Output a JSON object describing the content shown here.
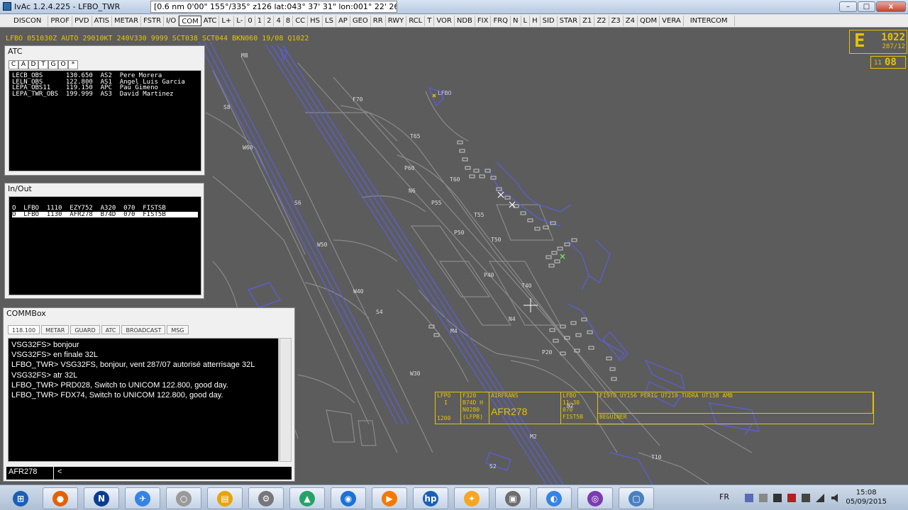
{
  "window": {
    "title": "IvAc 1.2.4.225 - LFBO_TWR",
    "readout": "[0.6 nm   0'00\"   155°/335°   z126    lat:043° 37' 31\"  lon:001° 22' 26\"]",
    "min": "–",
    "max": "□",
    "close": "x"
  },
  "toolbar": [
    "DISCON",
    "PROF",
    "PVD",
    "ATIS",
    "METAR",
    "FSTR",
    "I/O",
    "COM",
    "ATC",
    "L+",
    "L-",
    "0",
    "1",
    "2",
    "4",
    "8",
    "CC",
    "HS",
    "LS",
    "AP",
    "GEO",
    "RR",
    "RWY",
    "RCL",
    "T",
    "VOR",
    "NDB",
    "FIX",
    "FRQ",
    "N",
    "L",
    "H",
    "SID",
    "STAR",
    "Z1",
    "Z2",
    "Z3",
    "Z4",
    "QDM",
    "VERA",
    "INTERCOM"
  ],
  "toolbar_active": "COM",
  "metar": "LFBO 051030Z AUTO 29010KT 240V330 9999 SCT038 SCT044 BKN060 19/08 Q1022",
  "atis_box": {
    "letter": "E",
    "qnh": "1022",
    "wind": "287/12"
  },
  "clock_box": {
    "hour": "11",
    "min": "08"
  },
  "map_labels": [
    "M8",
    "S8",
    "W60",
    "F70",
    "LFBO",
    "T65",
    "P60",
    "N6",
    "T60",
    "S6",
    "P55",
    "T55",
    "P50",
    "T50",
    "W50",
    "P40",
    "T40",
    "W40",
    "S4",
    "M4",
    "N4",
    "P20",
    "W30",
    "N2",
    "M2",
    "T10",
    "S2"
  ],
  "atc_panel": {
    "title": "ATC",
    "tabs": [
      "C",
      "A",
      "D",
      "T",
      "G",
      "O",
      "*"
    ],
    "rows": [
      "LECB_OBS      130.650  AS2  Pere Morera",
      "LELN_OBS      122.800  AS1  Angel Luis Garcia",
      "LEPA_OBS11    119.150  APC  Pau Gimeno",
      "LEPA_TWR_OBS  199.999  AS3  David Martinez"
    ]
  },
  "inout_panel": {
    "title": "In/Out",
    "rows": [
      "O  LFBO  1110  EZY752  A320  070  FISTSB",
      "O  LFBO  1130  AFR278  B74D  070  FIST5B"
    ],
    "selected_row": 1
  },
  "commbox": {
    "title": "COMMBox",
    "tabs": [
      "118.100",
      "METAR",
      "GUARD",
      "ATC",
      "BROADCAST",
      "MSG"
    ],
    "messages": [
      "VSG32FS> bonjour",
      "VSG32FS> en finale 32L",
      "LFBO_TWR> VSG32FS, bonjour, vent 287/07 autorisé atterrisage 32L",
      "VSG32FS> atr 32L",
      "LFBO_TWR> PRD028, Switch to UNICOM 122.800, good day.",
      "LFBO_TWR> FDX74, Switch to UNICOM 122.800, good day."
    ],
    "callsign": "AFR278",
    "command": "<"
  },
  "strip": {
    "c1a": "LFPO",
    "c1b": "I",
    "c1c": "1200",
    "c2a": "F320",
    "c2b": "B74D H",
    "c2c": "N0280",
    "c2d": "(LFPB)",
    "c3a": "AIRFRANS",
    "c3b": "AFR278",
    "c4a": "LFBO",
    "c4b": "11:30",
    "c4c": "070",
    "c4d": "FIST5B",
    "route": "FISTO UY156 PERIG UT210 TUDRA UT158 AMB",
    "remark": "BEGUINER"
  },
  "taskbar": {
    "lang": "FR",
    "time": "15:08",
    "date": "05/09/2015",
    "icons": [
      "start-orb-icon",
      "firefox-icon",
      "n-app-icon",
      "airplane-icon",
      "globe-icon",
      "folder-icon",
      "settings-icon",
      "green-app-icon",
      "teamspeak-icon",
      "media-player-icon",
      "hp-icon",
      "orange-app-icon",
      "ivac-icon",
      "browser-icon",
      "circle-app-icon",
      "window-icon"
    ]
  }
}
